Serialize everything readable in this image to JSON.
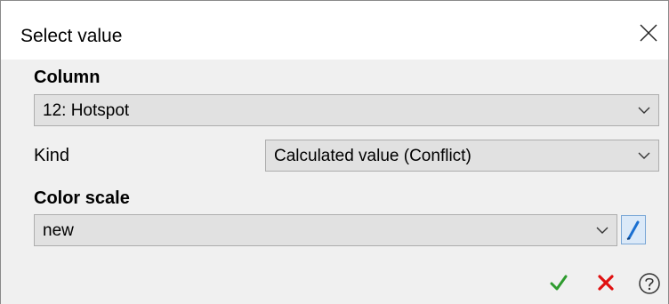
{
  "window": {
    "title": "Select value"
  },
  "column": {
    "section_label": "Column",
    "selected": "12: Hotspot"
  },
  "kind": {
    "label": "Kind",
    "selected": "Calculated value (Conflict)"
  },
  "color_scale": {
    "section_label": "Color scale",
    "selected": "new"
  },
  "icons": {
    "close": "close-icon",
    "chevron": "chevron-down-icon",
    "edit": "pencil-icon",
    "ok": "checkmark-icon",
    "cancel": "x-icon",
    "help": "question-icon"
  },
  "colors": {
    "ok_green": "#2e9b2e",
    "cancel_red": "#e01010",
    "edit_blue": "#1a6fd1"
  }
}
